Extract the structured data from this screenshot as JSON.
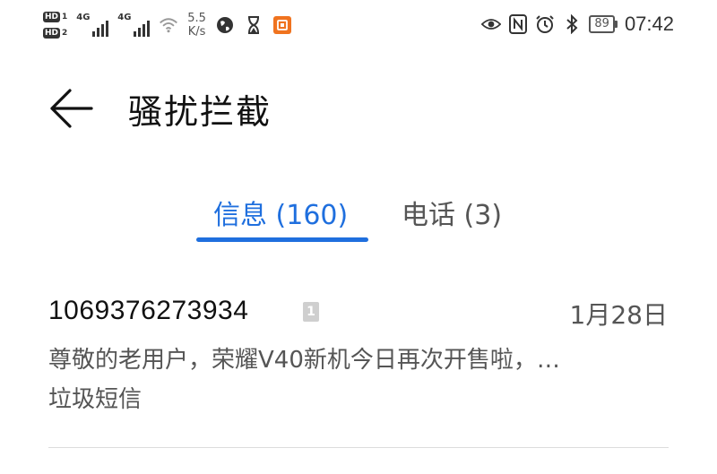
{
  "status_bar": {
    "sim1_badge": "HD",
    "sim1_index": "1",
    "sim2_badge": "HD",
    "sim2_index": "2",
    "signal1_type": "4G",
    "signal2_type": "4G",
    "net_speed_value": "5.5",
    "net_speed_unit": "K/s",
    "battery": "89",
    "time": "07:42",
    "icons": [
      "wifi-icon",
      "globe-icon",
      "hourglass-icon",
      "app-notification-icon",
      "eye-icon",
      "nfc-icon",
      "alarm-icon",
      "bluetooth-icon"
    ]
  },
  "header": {
    "title": "骚扰拦截"
  },
  "tabs": [
    {
      "label": "信息 (160)",
      "active": true
    },
    {
      "label": "电话 (3)",
      "active": false
    }
  ],
  "colors": {
    "accent": "#1f6fde",
    "app_icon": "#f0731f"
  },
  "messages": [
    {
      "sender": "1069376273934",
      "sim": "1",
      "date": "1月28日",
      "preview": "尊敬的老用户，荣耀V40新机今日再次开售啦，…",
      "tag": "垃圾短信"
    }
  ]
}
